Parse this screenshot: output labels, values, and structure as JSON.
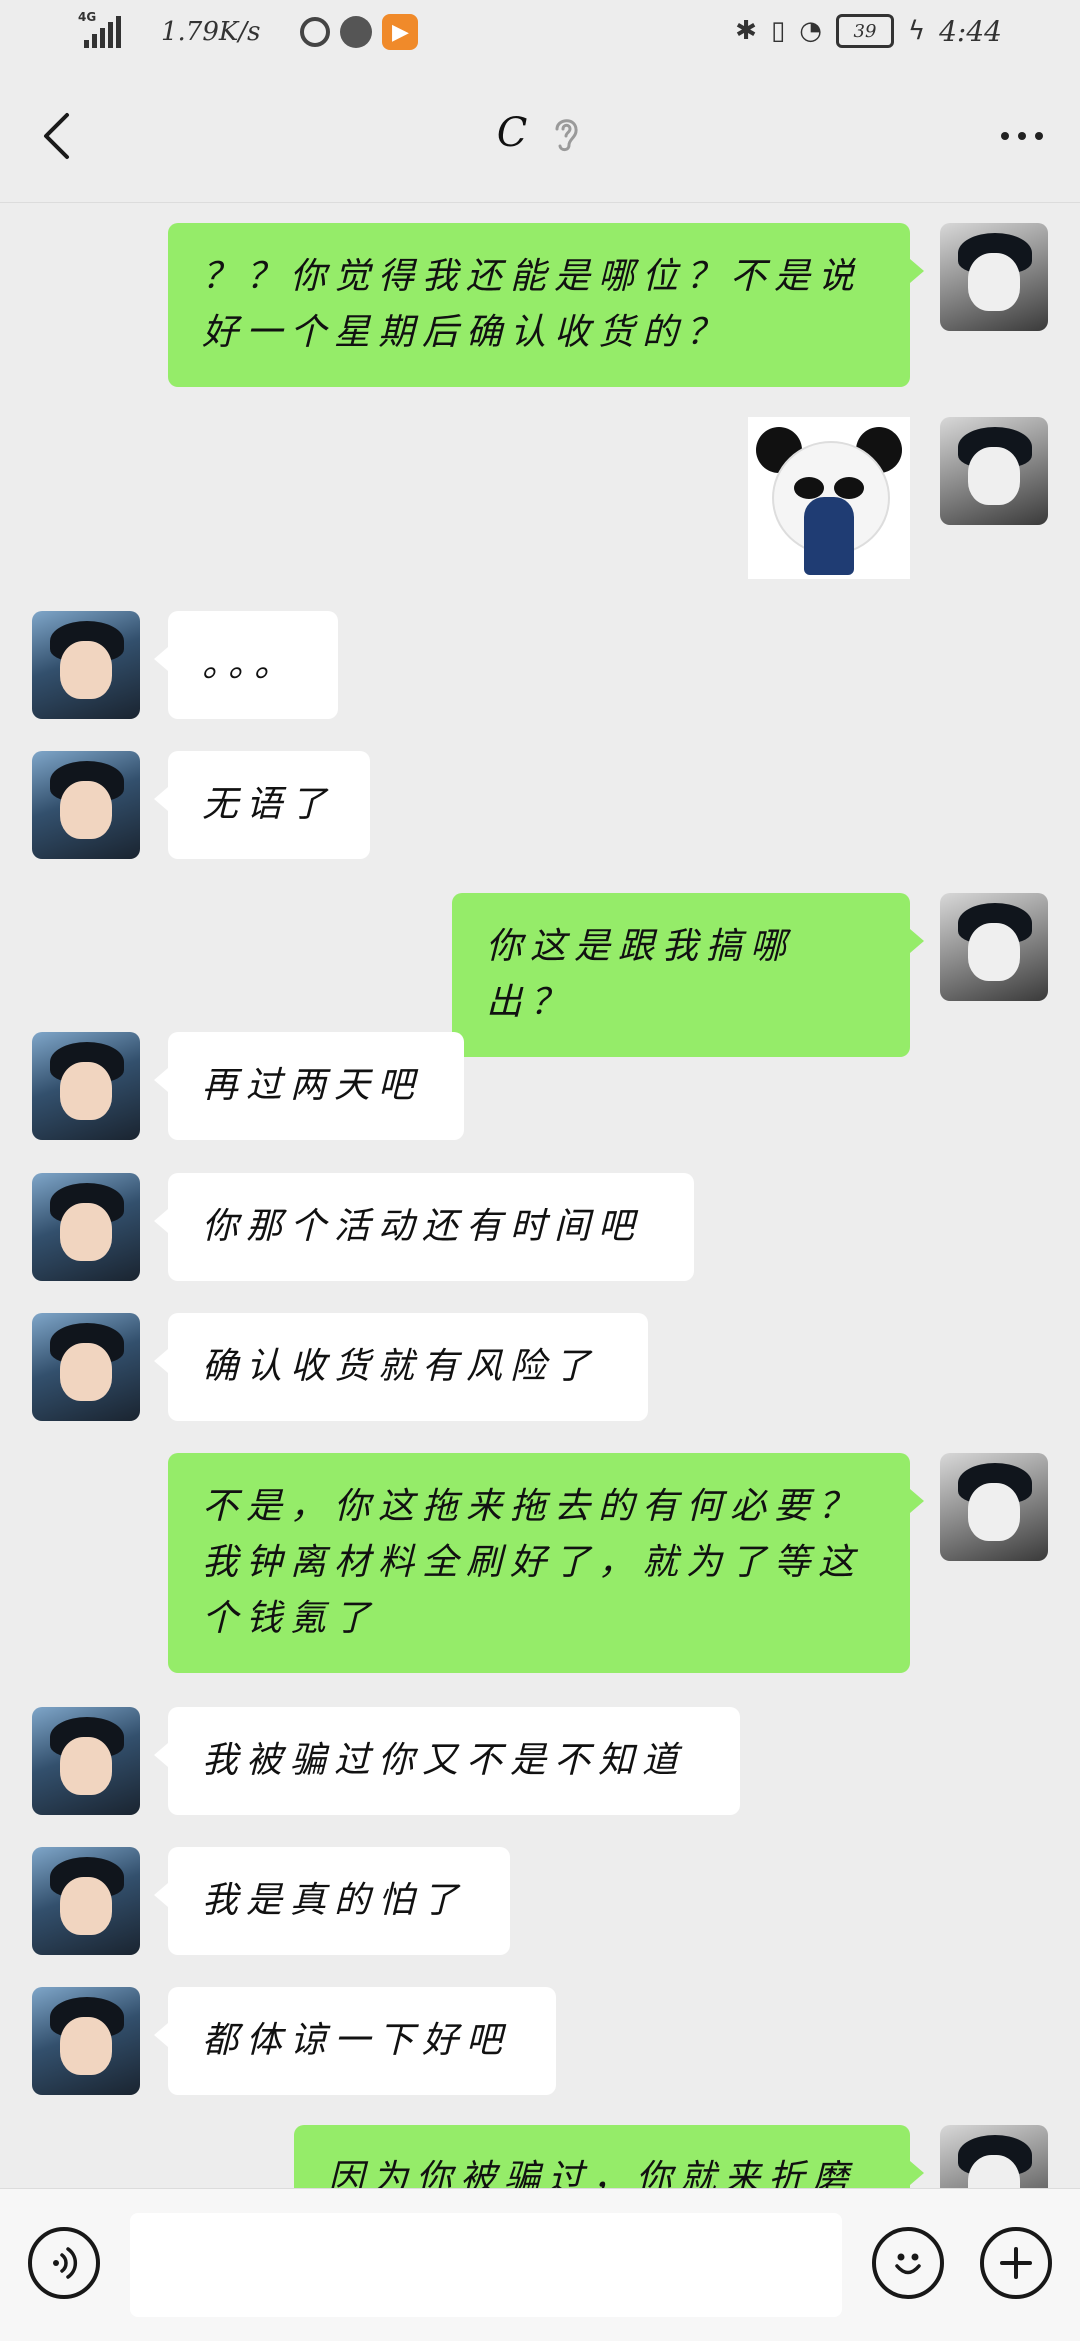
{
  "status_bar": {
    "network": "4G",
    "speed": "1.79K/s",
    "battery": "39",
    "time": "4:44"
  },
  "header": {
    "title": "C"
  },
  "messages": [
    {
      "side": "out",
      "type": "text",
      "text": "？？你觉得我还能是哪位？不是说好一个星期后确认收货的？"
    },
    {
      "side": "out",
      "type": "sticker",
      "sticker": "crying-panda"
    },
    {
      "side": "in",
      "type": "text",
      "text": "。。。"
    },
    {
      "side": "in",
      "type": "text",
      "text": "无语了"
    },
    {
      "side": "out",
      "type": "text",
      "text": "你这是跟我搞哪出？"
    },
    {
      "side": "in",
      "type": "text",
      "text": "再过两天吧"
    },
    {
      "side": "in",
      "type": "text",
      "text": "你那个活动还有时间吧"
    },
    {
      "side": "in",
      "type": "text",
      "text": "确认收货就有风险了"
    },
    {
      "side": "out",
      "type": "text",
      "text": "不是，你这拖来拖去的有何必要？我钟离材料全刷好了，就为了等这个钱氪了"
    },
    {
      "side": "in",
      "type": "text",
      "text": "我被骗过你又不是不知道"
    },
    {
      "side": "in",
      "type": "text",
      "text": "我是真的怕了"
    },
    {
      "side": "in",
      "type": "text",
      "text": "都体谅一下好吧"
    },
    {
      "side": "out",
      "type": "text",
      "text": "因为你被骗过，你就来折磨"
    }
  ],
  "input": {
    "value": "",
    "placeholder": ""
  },
  "colors": {
    "background": "#ededed",
    "outgoing_bubble": "#95ec69",
    "incoming_bubble": "#ffffff"
  },
  "icons": [
    "back-arrow-icon",
    "ear-icon",
    "more-icon",
    "voice-icon",
    "emoji-icon",
    "plus-icon"
  ]
}
